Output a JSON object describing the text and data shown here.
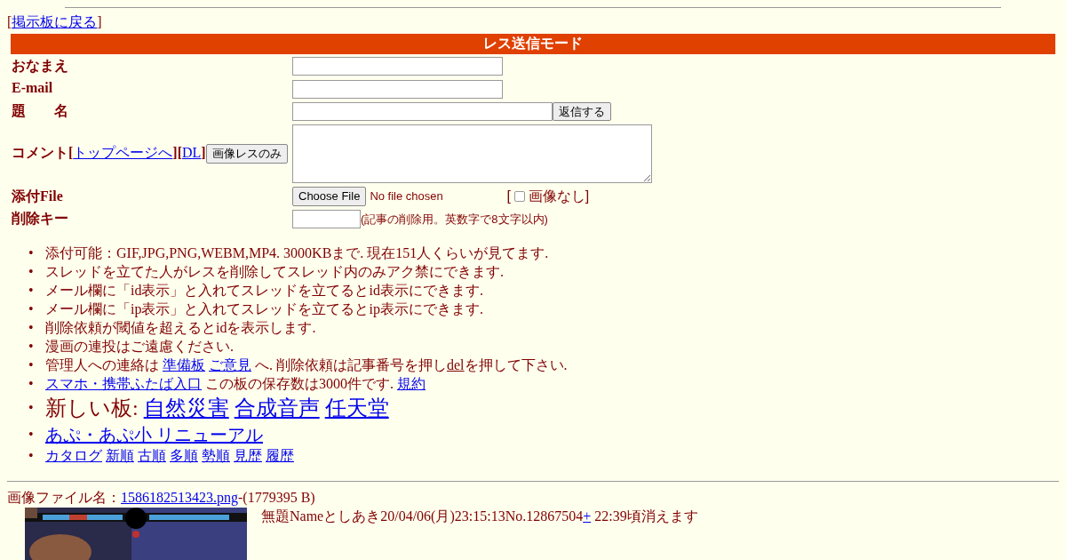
{
  "back_link": {
    "open": "[",
    "text": "掲示板に戻る",
    "close": "]"
  },
  "form": {
    "title": "レス送信モード",
    "name_label": "おなまえ",
    "email_label": "E-mail",
    "subject_label": "題　　名",
    "submit": "返信する",
    "comment_label": "コメント",
    "comment_links": [
      {
        "open": "[",
        "text": "トップページへ",
        "close": "]"
      },
      {
        "open": "[",
        "text": "DL",
        "close": "]"
      }
    ],
    "image_only_button": "画像レスのみ",
    "file_label": "添付File",
    "file_button": "Choose File",
    "file_status": "No file chosen",
    "no_image": {
      "open": "[",
      "label": "画像なし",
      "close": "]",
      "checked": false
    },
    "delete_label": "削除キー",
    "delete_hint": "(記事の削除用。英数字で8文字以内)"
  },
  "notice_bullet": "•",
  "notices": [
    {
      "kind": "normal",
      "parts": [
        {
          "kind": "text",
          "text": "添付可能：GIF,JPG,PNG,WEBM,MP4. 3000KBまで. 現在151人くらいが見てます."
        }
      ]
    },
    {
      "kind": "normal",
      "parts": [
        {
          "kind": "text",
          "text": "スレッドを立てた人がレスを削除してスレッド内のみアク禁にできます."
        }
      ]
    },
    {
      "kind": "normal",
      "parts": [
        {
          "kind": "text",
          "text": "メール欄に「id表示」と入れてスレッドを立てるとid表示にできます."
        }
      ]
    },
    {
      "kind": "normal",
      "parts": [
        {
          "kind": "text",
          "text": "メール欄に「ip表示」と入れてスレッドを立てるとip表示にできます."
        }
      ]
    },
    {
      "kind": "normal",
      "parts": [
        {
          "kind": "text",
          "text": "削除依頼が閾値を超えるとidを表示します."
        }
      ]
    },
    {
      "kind": "normal",
      "parts": [
        {
          "kind": "text",
          "text": "漫画の連投はご遠慮ください."
        }
      ]
    },
    {
      "kind": "normal",
      "parts": [
        {
          "kind": "text",
          "text": "管理人への連絡は"
        },
        {
          "kind": "link",
          "text": "準備板"
        },
        {
          "kind": "link",
          "text": "ご意見"
        },
        {
          "kind": "text",
          "text": "へ. 削除依頼は記事番号を押し"
        },
        {
          "kind": "underline",
          "text": "del"
        },
        {
          "kind": "text",
          "text": "を押して下さい."
        }
      ]
    },
    {
      "kind": "normal",
      "parts": [
        {
          "kind": "link",
          "text": "スマホ・携帯ふたば入口"
        },
        {
          "kind": "text",
          "text": "この板の保存数は3000件です."
        },
        {
          "kind": "link",
          "text": "規約"
        }
      ]
    },
    {
      "kind": "large",
      "parts": [
        {
          "kind": "text",
          "text": "新しい板:"
        },
        {
          "kind": "link",
          "text": "自然災害"
        },
        {
          "kind": "link",
          "text": "合成音声"
        },
        {
          "kind": "link",
          "text": "任天堂"
        }
      ]
    },
    {
      "kind": "medium",
      "parts": [
        {
          "kind": "link",
          "text": "あぷ・あぷ小 リニューアル"
        }
      ]
    },
    {
      "kind": "normal",
      "parts": [
        {
          "kind": "link",
          "text": "カタログ"
        },
        {
          "kind": "link",
          "text": "新順"
        },
        {
          "kind": "link",
          "text": "古順"
        },
        {
          "kind": "link",
          "text": "多順"
        },
        {
          "kind": "link",
          "text": "勢順"
        },
        {
          "kind": "link",
          "text": "見歴"
        },
        {
          "kind": "link",
          "text": "履歴"
        }
      ]
    }
  ],
  "post": {
    "file_prefix": "画像ファイル名：",
    "file_name": "1586182513423.png",
    "file_size": "-(1779395 B)",
    "header": "無題Nameとしあき20/04/06(月)23:15:13No.12867504",
    "plus": "+",
    "expiry": "22:39頃消えます"
  }
}
